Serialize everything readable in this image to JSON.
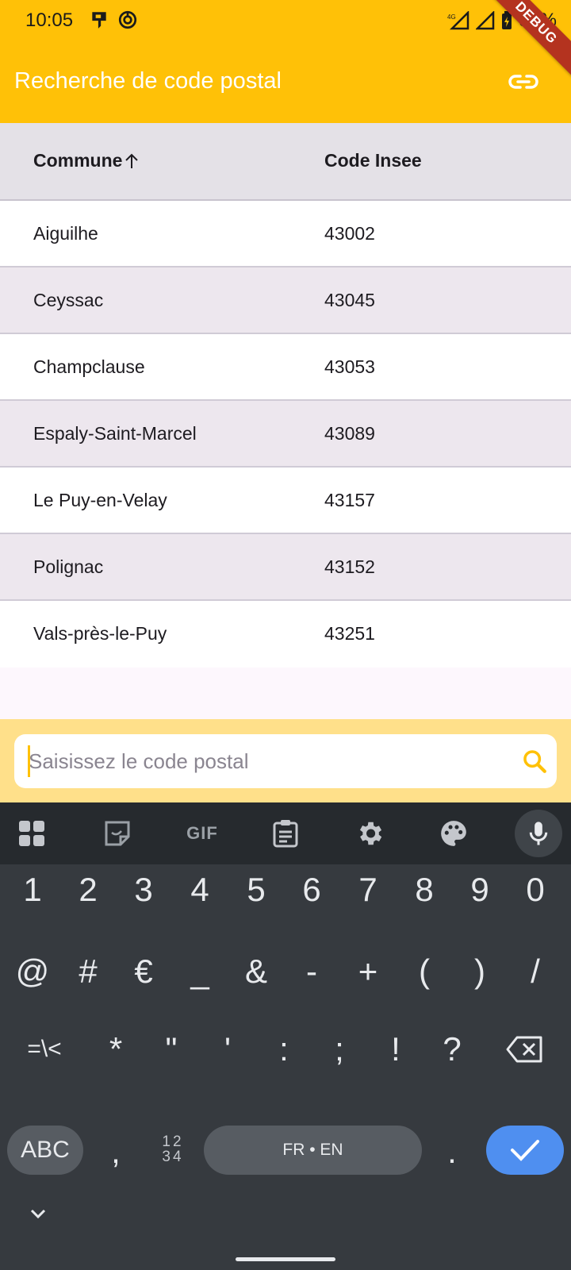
{
  "status_bar": {
    "time": "10:05",
    "network": "4G",
    "battery": "95%"
  },
  "debug_banner": "DEBUG",
  "app_bar": {
    "title": "Recherche de code postal",
    "action_icon": "link-icon"
  },
  "table": {
    "columns": [
      {
        "label": "Commune",
        "sort": "ascending"
      },
      {
        "label": "Code Insee"
      }
    ],
    "rows": [
      {
        "commune": "Aiguilhe",
        "insee": "43002"
      },
      {
        "commune": "Ceyssac",
        "insee": "43045"
      },
      {
        "commune": "Champclause",
        "insee": "43053"
      },
      {
        "commune": "Espaly-Saint-Marcel",
        "insee": "43089"
      },
      {
        "commune": "Le Puy-en-Velay",
        "insee": "43157"
      },
      {
        "commune": "Polignac",
        "insee": "43152"
      },
      {
        "commune": "Vals-près-le-Puy",
        "insee": "43251"
      }
    ]
  },
  "search": {
    "placeholder": "Saisissez le code postal",
    "value": "",
    "icon": "search-icon"
  },
  "keyboard": {
    "toolbar_icons": [
      "apps-icon",
      "sticker-icon",
      "gif-icon",
      "clipboard-icon",
      "settings-icon",
      "palette-icon",
      "mic-icon"
    ],
    "gif_label": "GIF",
    "row1": [
      "1",
      "2",
      "3",
      "4",
      "5",
      "6",
      "7",
      "8",
      "9",
      "0"
    ],
    "row2": [
      "@",
      "#",
      "€",
      "_",
      "&",
      "-",
      "+",
      "(",
      ")",
      "/"
    ],
    "row3": [
      "=\\<",
      "*",
      "\"",
      "'",
      ":",
      ";",
      "!",
      "?"
    ],
    "abc_label": "ABC",
    "comma": ",",
    "numpad_label_top": "12",
    "numpad_label_bottom": "34",
    "space_label": "FR • EN",
    "period": "."
  },
  "colors": {
    "primary": "#ffc107",
    "search_bar_bg": "#ffe08a",
    "header_row_bg": "#e4e1e7",
    "alt_row_bg": "#ede7ee",
    "keyboard_bg": "#363a3f",
    "enter_key": "#4f8ff0",
    "debug_ribbon": "#b4331f"
  }
}
